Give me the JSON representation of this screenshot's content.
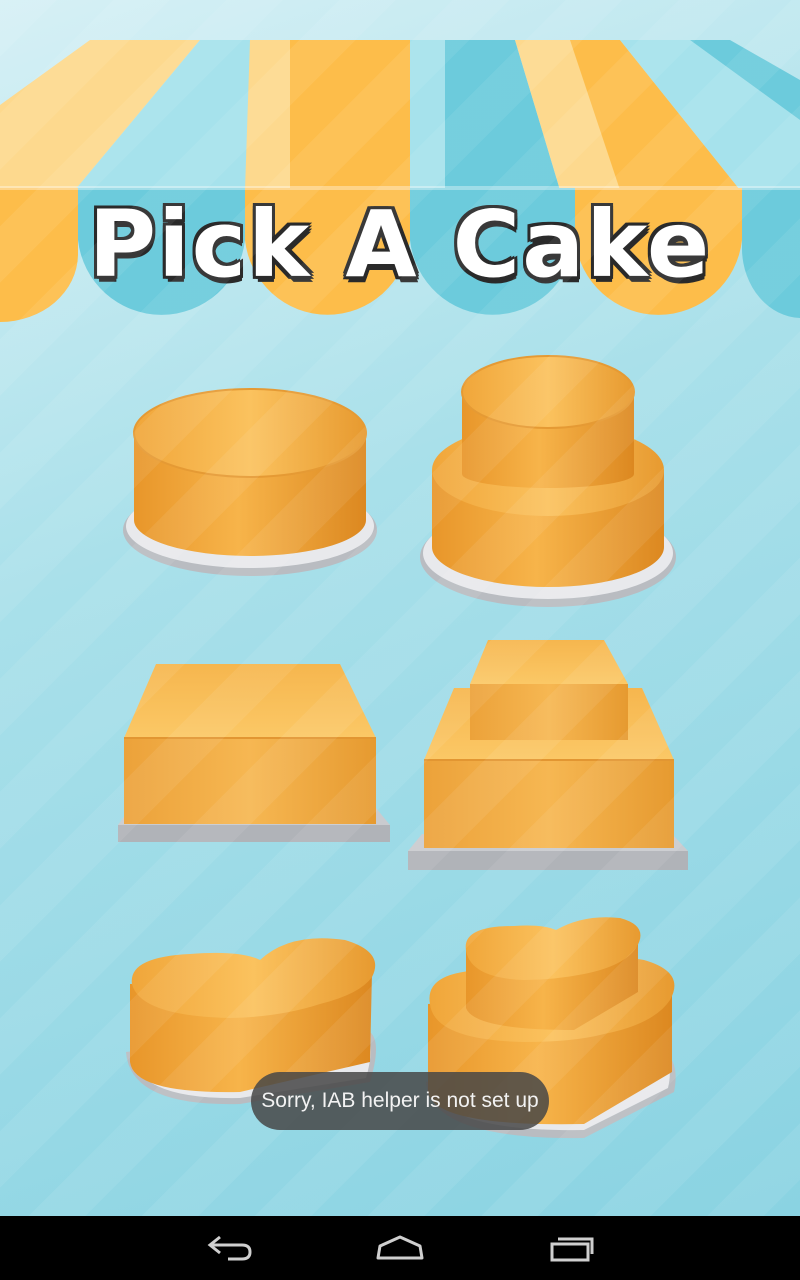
{
  "screen": {
    "title": "Pick A Cake",
    "awning_colors": {
      "yellow": "#fdbd4a",
      "light_yellow": "#fdd98e",
      "blue": "#6ccbdc",
      "light_blue": "#a6e2ec"
    },
    "cakes": [
      {
        "shape": "round",
        "tiers": 1
      },
      {
        "shape": "round",
        "tiers": 2
      },
      {
        "shape": "square",
        "tiers": 1
      },
      {
        "shape": "square",
        "tiers": 2
      },
      {
        "shape": "heart",
        "tiers": 1
      },
      {
        "shape": "heart",
        "tiers": 2
      }
    ]
  },
  "toast": {
    "message": "Sorry, IAB helper is not set up"
  },
  "navbar": {
    "buttons": [
      "back-icon",
      "home-icon",
      "recent-apps-icon"
    ]
  }
}
